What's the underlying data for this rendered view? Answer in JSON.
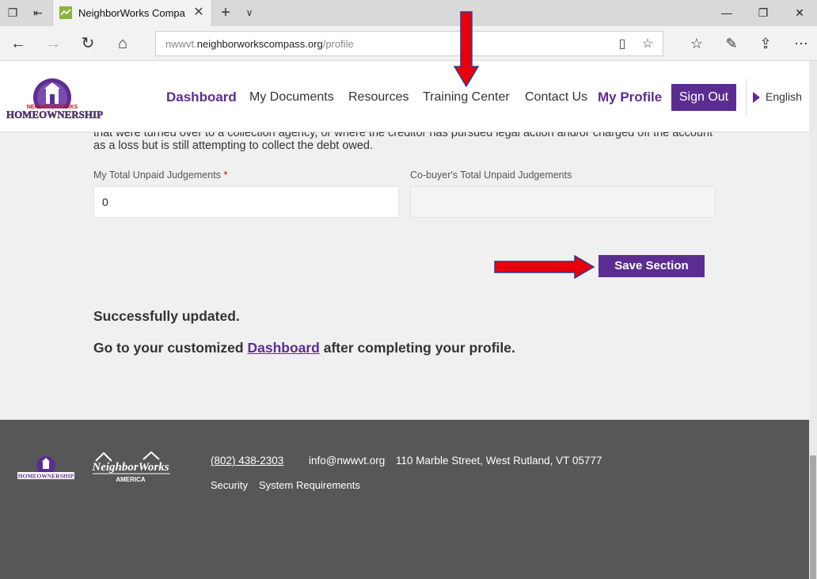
{
  "browser": {
    "tab_title": "NeighborWorks Compa",
    "url_prefix": "nwwvt.",
    "url_domain": "neighborworkscompass.org",
    "url_path": "/profile"
  },
  "header": {
    "nav": [
      "Dashboard",
      "My Documents",
      "Resources",
      "Training Center",
      "Contact Us",
      "My Profile"
    ],
    "sign_out": "Sign Out",
    "language": "English",
    "logo_text": "HOMEOWNERSHIP",
    "logo_sub": "NEIGHBORWORKS"
  },
  "form": {
    "description": "that were turned over to a collection agency, or where the creditor has pursued legal action and/or charged off the account as a loss but is still attempting to collect the debt owed.",
    "my_label": "My Total Unpaid Judgements",
    "required_mark": "*",
    "my_value": "0",
    "cobuyer_label": "Co-buyer's Total Unpaid Judgements",
    "cobuyer_value": "",
    "save_label": "Save Section"
  },
  "messages": {
    "success": "Successfully updated.",
    "goto_prefix": "Go to your customized ",
    "goto_link": "Dashboard",
    "goto_suffix": " after completing your profile."
  },
  "footer": {
    "phone": "(802) 438-2303",
    "email": "info@nwwvt.org",
    "address": "110 Marble Street, West Rutland, VT 05777",
    "links": [
      "Security",
      "System Requirements"
    ],
    "nw_logo_text": "NeighborWorks",
    "nw_logo_sub": "AMERICA"
  },
  "colors": {
    "brand_purple": "#5c2d91",
    "annotation_arrow": "#e8000b",
    "footer_bg": "#575757"
  }
}
